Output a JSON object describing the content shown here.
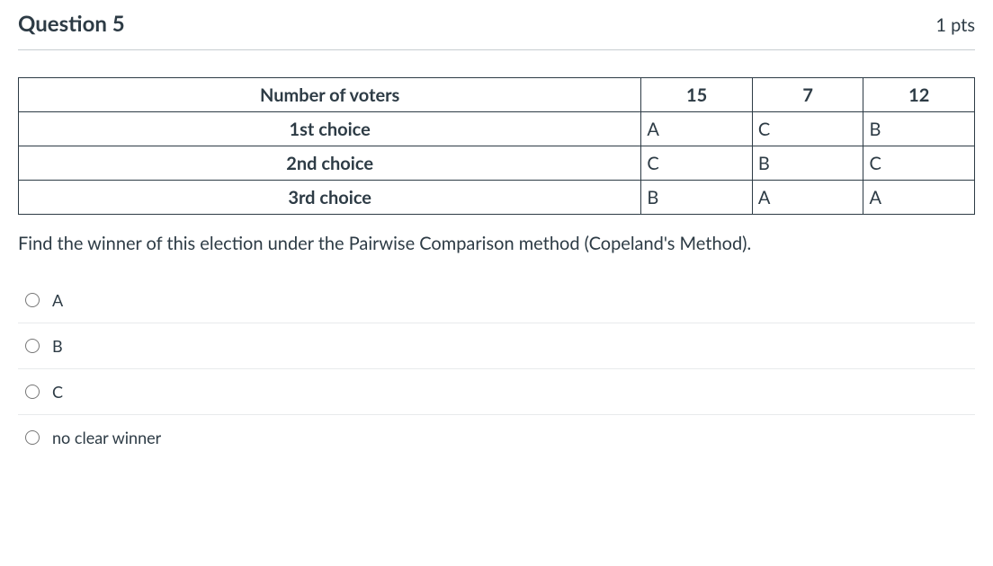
{
  "header": {
    "title": "Question 5",
    "points": "1 pts"
  },
  "table": {
    "row_labels": [
      "Number of voters",
      "1st choice",
      "2nd choice",
      "3rd choice"
    ],
    "columns": [
      {
        "voters": "15",
        "choices": [
          "A",
          "C",
          "B"
        ]
      },
      {
        "voters": "7",
        "choices": [
          "C",
          "B",
          "A"
        ]
      },
      {
        "voters": "12",
        "choices": [
          "B",
          "C",
          "A"
        ]
      }
    ]
  },
  "prompt": "Find the winner of this election under the Pairwise Comparison method (Copeland's Method).",
  "options": [
    {
      "label": "A"
    },
    {
      "label": "B"
    },
    {
      "label": "C"
    },
    {
      "label": "no clear winner"
    }
  ]
}
